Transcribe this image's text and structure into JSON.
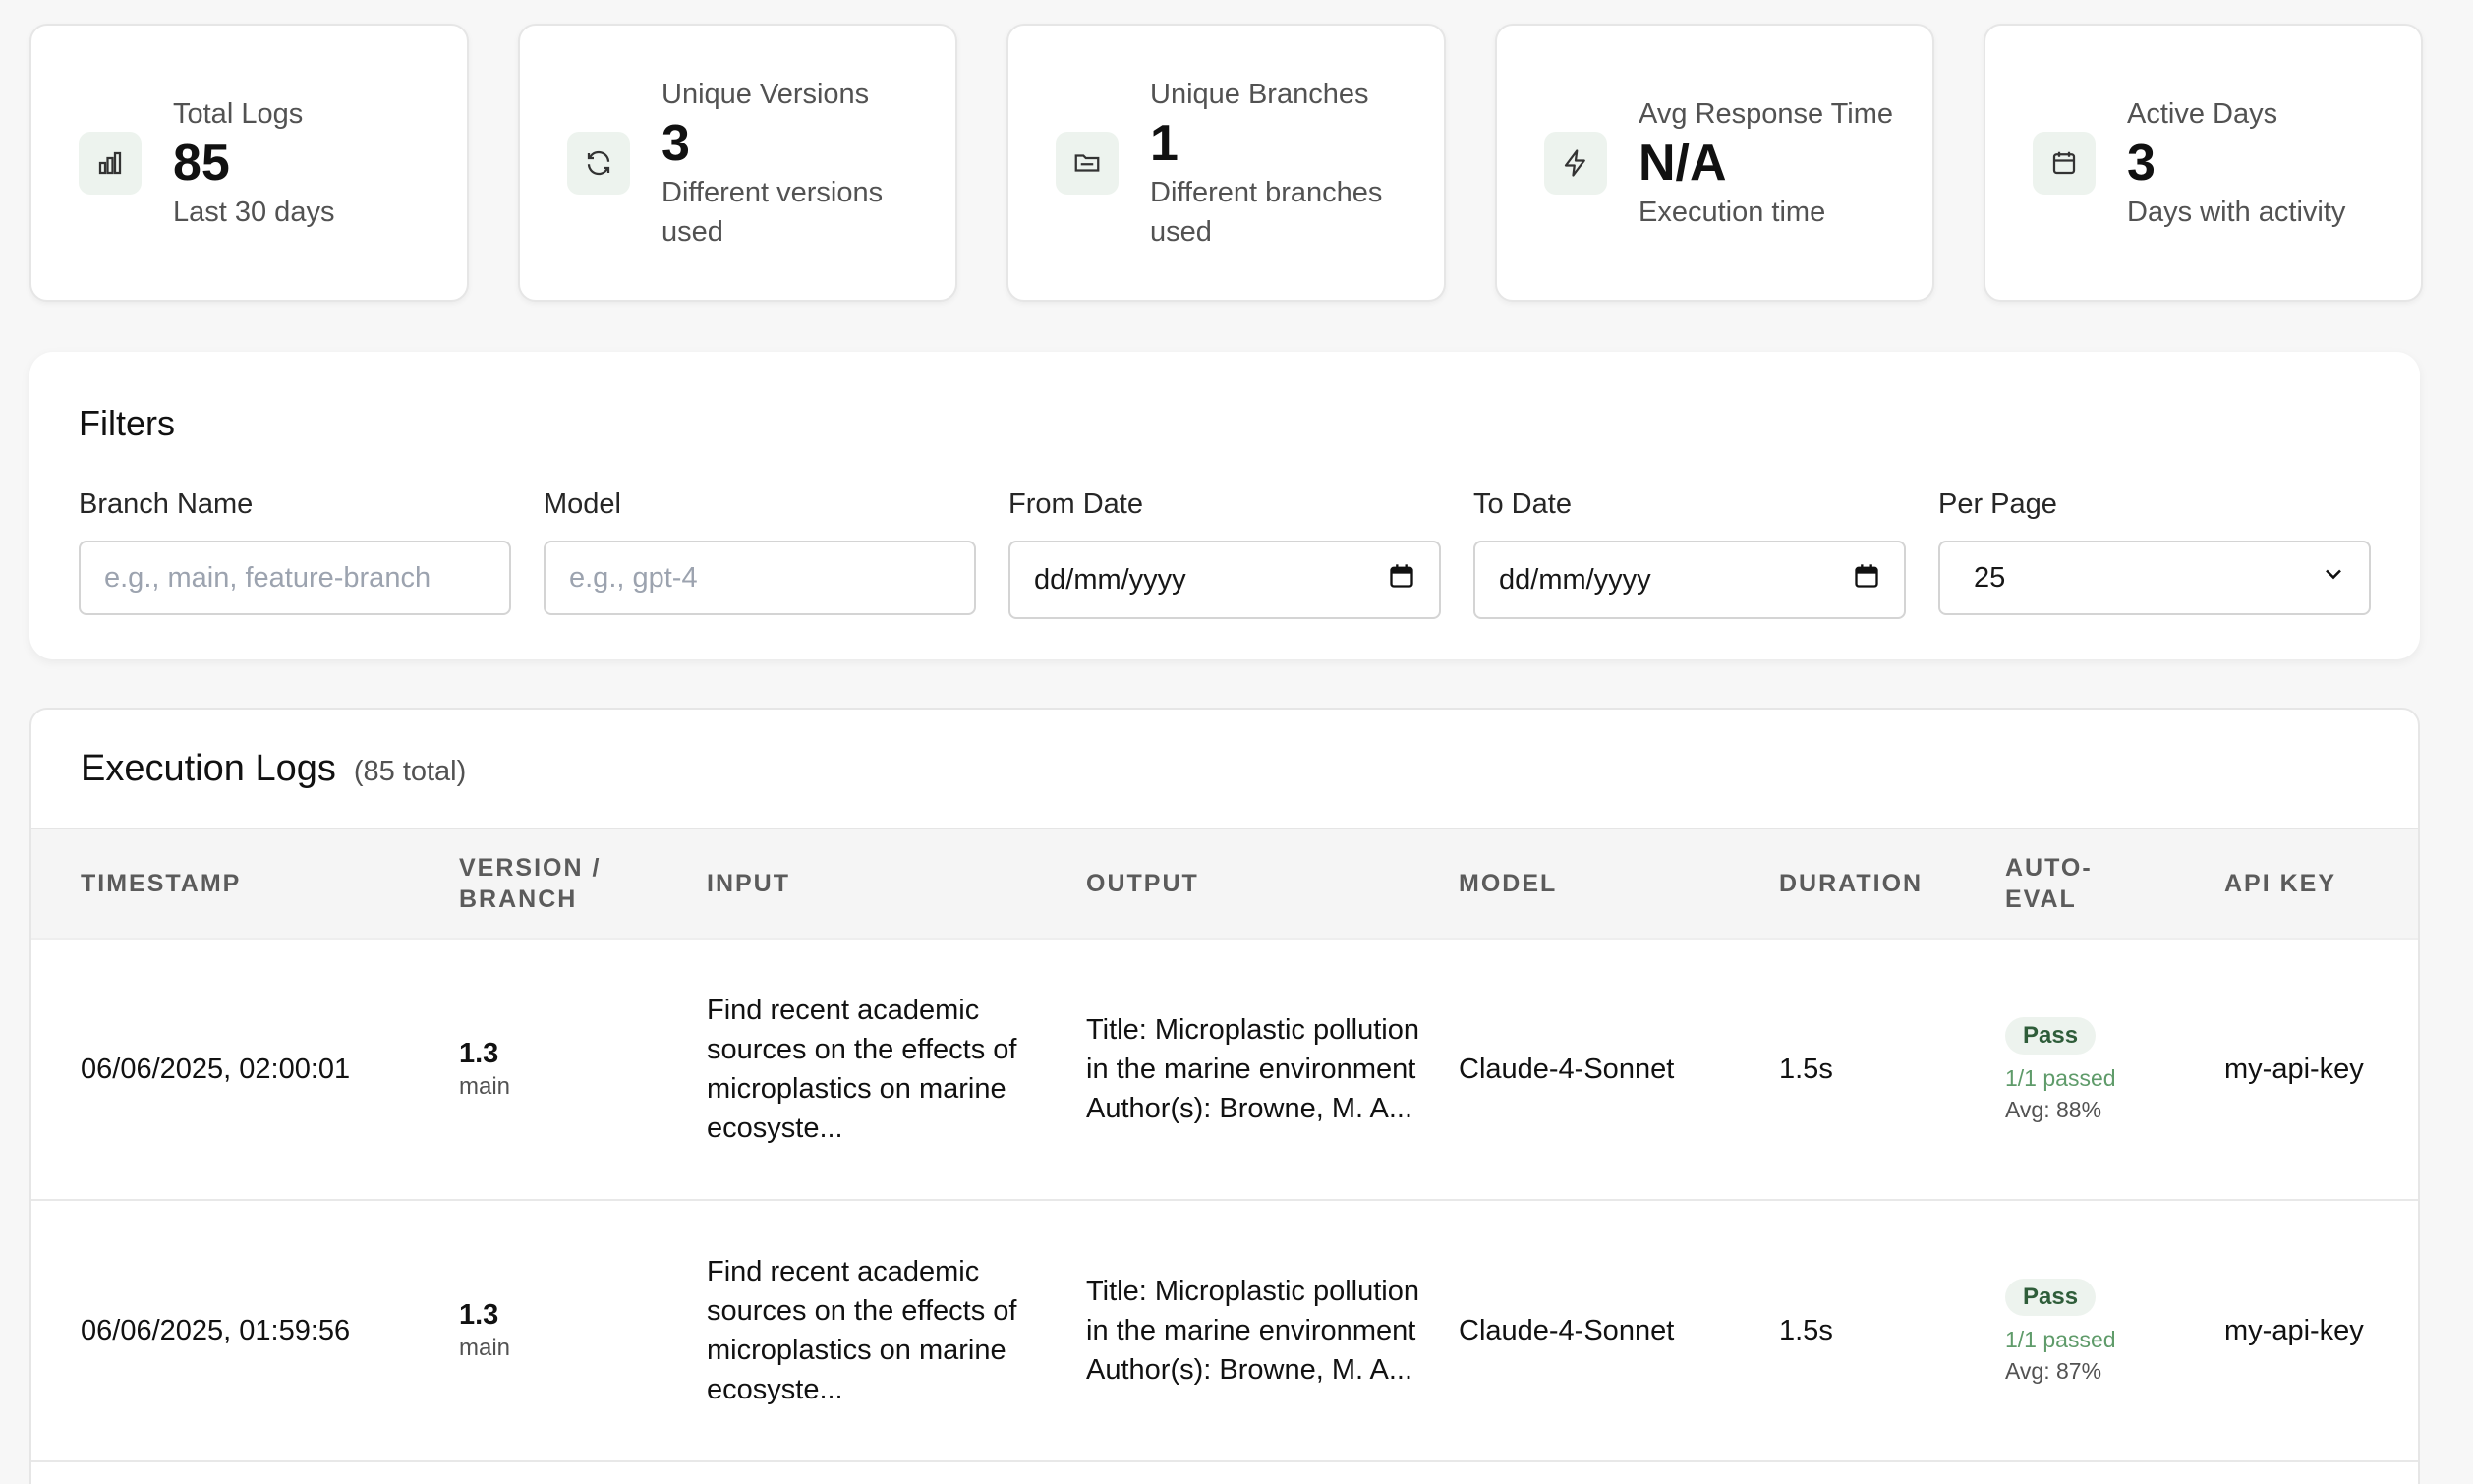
{
  "stats": [
    {
      "label": "Total Logs",
      "value": "85",
      "sub": "Last 30 days",
      "icon": "bar-chart-icon"
    },
    {
      "label": "Unique Versions",
      "value": "3",
      "sub": "Different versions used",
      "icon": "refresh-icon"
    },
    {
      "label": "Unique Branches",
      "value": "1",
      "sub": "Different branches used",
      "icon": "folder-icon"
    },
    {
      "label": "Avg Response Time",
      "value": "N/A",
      "sub": "Execution time",
      "icon": "lightning-icon"
    },
    {
      "label": "Active Days",
      "value": "3",
      "sub": "Days with activity",
      "icon": "calendar-icon"
    }
  ],
  "filters": {
    "title": "Filters",
    "branch": {
      "label": "Branch Name",
      "placeholder": "e.g., main, feature-branch"
    },
    "model": {
      "label": "Model",
      "placeholder": "e.g., gpt-4"
    },
    "from_date": {
      "label": "From Date",
      "value": "dd/mm/yyyy"
    },
    "to_date": {
      "label": "To Date",
      "value": "dd/mm/yyyy"
    },
    "per_page": {
      "label": "Per Page",
      "value": "25"
    }
  },
  "logs": {
    "title": "Execution Logs",
    "count": "(85 total)",
    "columns": [
      "TIMESTAMP",
      "VERSION / BRANCH",
      "INPUT",
      "OUTPUT",
      "MODEL",
      "DURATION",
      "AUTO-EVAL",
      "API KEY"
    ],
    "rows": [
      {
        "timestamp": "06/06/2025, 02:00:01",
        "version": "1.3",
        "branch": "main",
        "input": "Find recent academic sources on the effects of microplastics on marine ecosyste...",
        "output": "Title: Microplastic pollution in the marine environment Author(s): Browne, M. A...",
        "model": "Claude-4-Sonnet",
        "duration": "1.5s",
        "eval_status": "Pass",
        "eval_passed": "1/1 passed",
        "eval_avg": "Avg: 88%",
        "api_key": "my-api-key"
      },
      {
        "timestamp": "06/06/2025, 01:59:56",
        "version": "1.3",
        "branch": "main",
        "input": "Find recent academic sources on the effects of microplastics on marine ecosyste...",
        "output": "Title: Microplastic pollution in the marine environment Author(s): Browne, M. A...",
        "model": "Claude-4-Sonnet",
        "duration": "1.5s",
        "eval_status": "Pass",
        "eval_passed": "1/1 passed",
        "eval_avg": "Avg: 87%",
        "api_key": "my-api-key"
      }
    ]
  }
}
